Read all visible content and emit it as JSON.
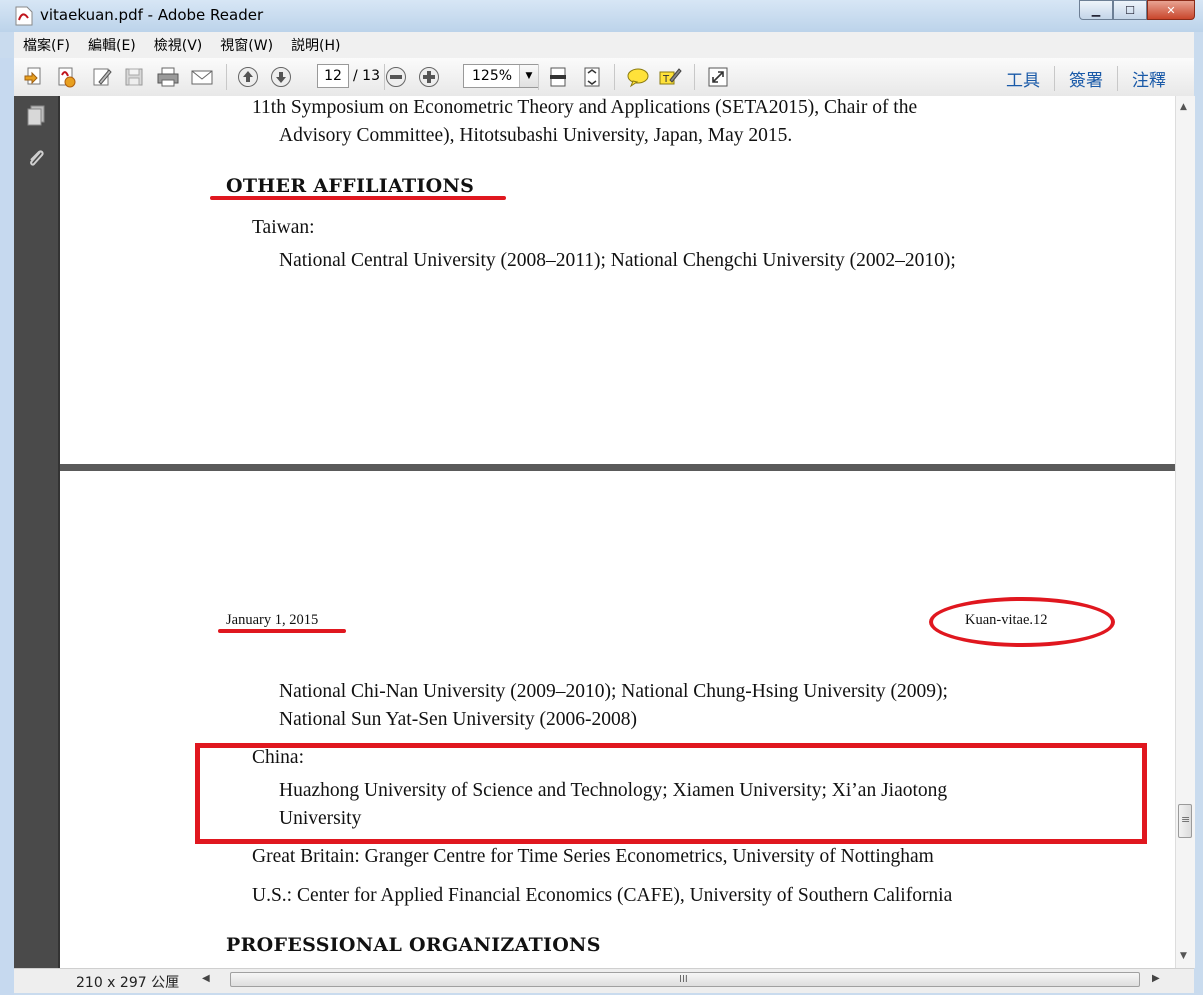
{
  "window": {
    "title": "vitaekuan.pdf - Adobe Reader",
    "min_glyph": "▁",
    "max_glyph": "☐",
    "close_glyph": "✕"
  },
  "menu": {
    "items": [
      "檔案(F)",
      "編輯(E)",
      "檢視(V)",
      "視窗(W)",
      "説明(H)"
    ]
  },
  "toolbar": {
    "page_current": "12",
    "page_total": "/ 13",
    "zoom": "125%",
    "right_links": [
      "工具",
      "簽署",
      "注釋"
    ]
  },
  "document": {
    "page1": {
      "item_line1": "11th  Symposium  on  Econometric  Theory  and  Applications  (SETA2015),  Chair  of  the",
      "item_line2": "Advisory Committee), Hitotsubashi University, Japan, May 2015.",
      "section_heading": "OTHER AFFILIATIONS",
      "taiwan_label": "Taiwan:",
      "taiwan_line1": "National  Central  University  (2008–2011);  National  Chengchi  University  (2002–2010);"
    },
    "page2": {
      "header_date": "January 1, 2015",
      "header_page": "Kuan-vitae.12",
      "taiwan_line2": "National  Chi-Nan  University  (2009–2010);  National  Chung-Hsing  University  (2009);",
      "taiwan_line3": "National Sun Yat-Sen University (2006-2008)",
      "china_label": "China:",
      "china_line1": "Huazhong  University  of  Science  and  Technology;  Xiamen  University;  Xi’an  Jiaotong",
      "china_line2": "University",
      "gb_line": "Great Britain: Granger Centre for Time Series Econometrics, University of Nottingham",
      "us_line": "U.S.: Center for Applied Financial Economics (CAFE), University of Southern California",
      "next_heading": "PROFESSIONAL ORGANIZATIONS"
    }
  },
  "status": {
    "page_size": "210 x 297 公厘",
    "grip": "III",
    "left_arrow": "◀",
    "right_arrow": "▶"
  },
  "scroll": {
    "up_arrow": "▲",
    "down_arrow": "▼",
    "grip": "≡"
  },
  "colors": {
    "annotation_red": "#e0171f",
    "link_blue": "#1a5aa8"
  }
}
